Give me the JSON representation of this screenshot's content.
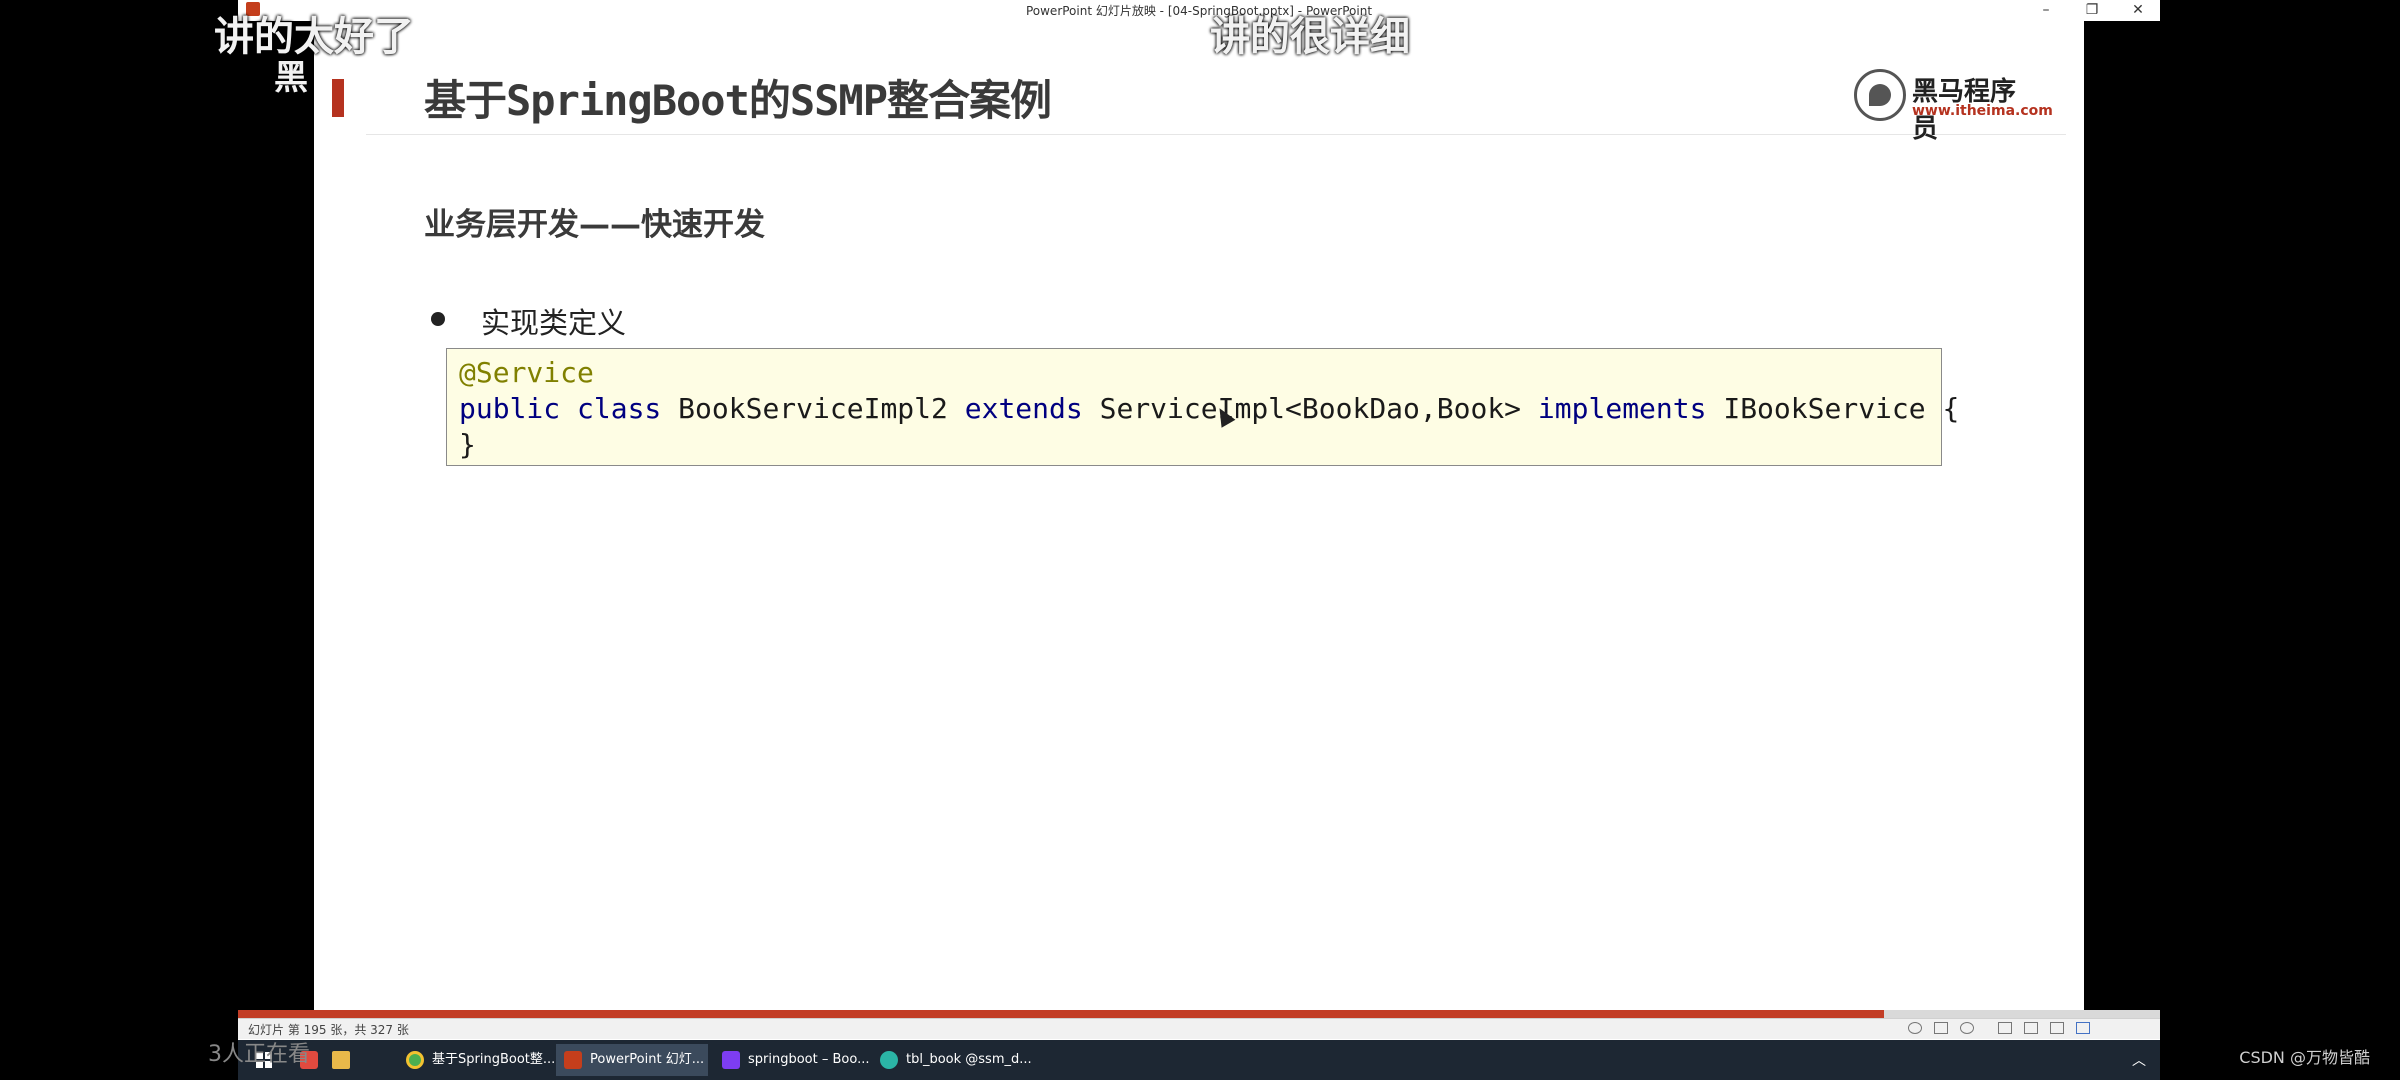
{
  "window": {
    "title": "PowerPoint 幻灯片放映 - [04-SpringBoot.pptx] - PowerPoint",
    "minimize": "–",
    "maximize": "❐",
    "close": "✕"
  },
  "slide": {
    "title": "基于SpringBoot的SSMP整合案例",
    "subtitle": "业务层开发——快速开发",
    "bullet": "实现类定义",
    "code": {
      "line1": "@Service",
      "line2_kw1": "public class",
      "line2_name": " BookServiceImpl2 ",
      "line2_kw2": "extends",
      "line2_parent": " ServiceImpl<BookDao,Book> ",
      "line2_kw3": "implements",
      "line2_iface": " IBookService {",
      "line3": "}"
    },
    "logo": {
      "name": "黑马程序员",
      "url": "www.itheima.com"
    }
  },
  "statusbar": {
    "text": "幻灯片 第 195 张，共 327 张"
  },
  "taskbar": {
    "items": [
      {
        "label": "基于SpringBoot整...",
        "icon": "chrome-icon"
      },
      {
        "label": "PowerPoint 幻灯...",
        "icon": "powerpoint-icon"
      },
      {
        "label": "springboot – Boo...",
        "icon": "intellij-icon"
      },
      {
        "label": "tbl_book @ssm_d...",
        "icon": "datagrip-icon"
      }
    ],
    "colors": {
      "background": "#1d2733",
      "active": "#3b4a5c"
    }
  },
  "overlays": {
    "danmaku_1": "讲的太好了",
    "danmaku_2": "讲的很详细",
    "danmaku_3": "黑",
    "viewers": "3人正在看",
    "watermark": "CSDN @万物皆酷"
  },
  "colors": {
    "accent_red": "#b5321f",
    "code_background": "#fefde4",
    "annotation": "#808000",
    "keyword": "#000080"
  }
}
